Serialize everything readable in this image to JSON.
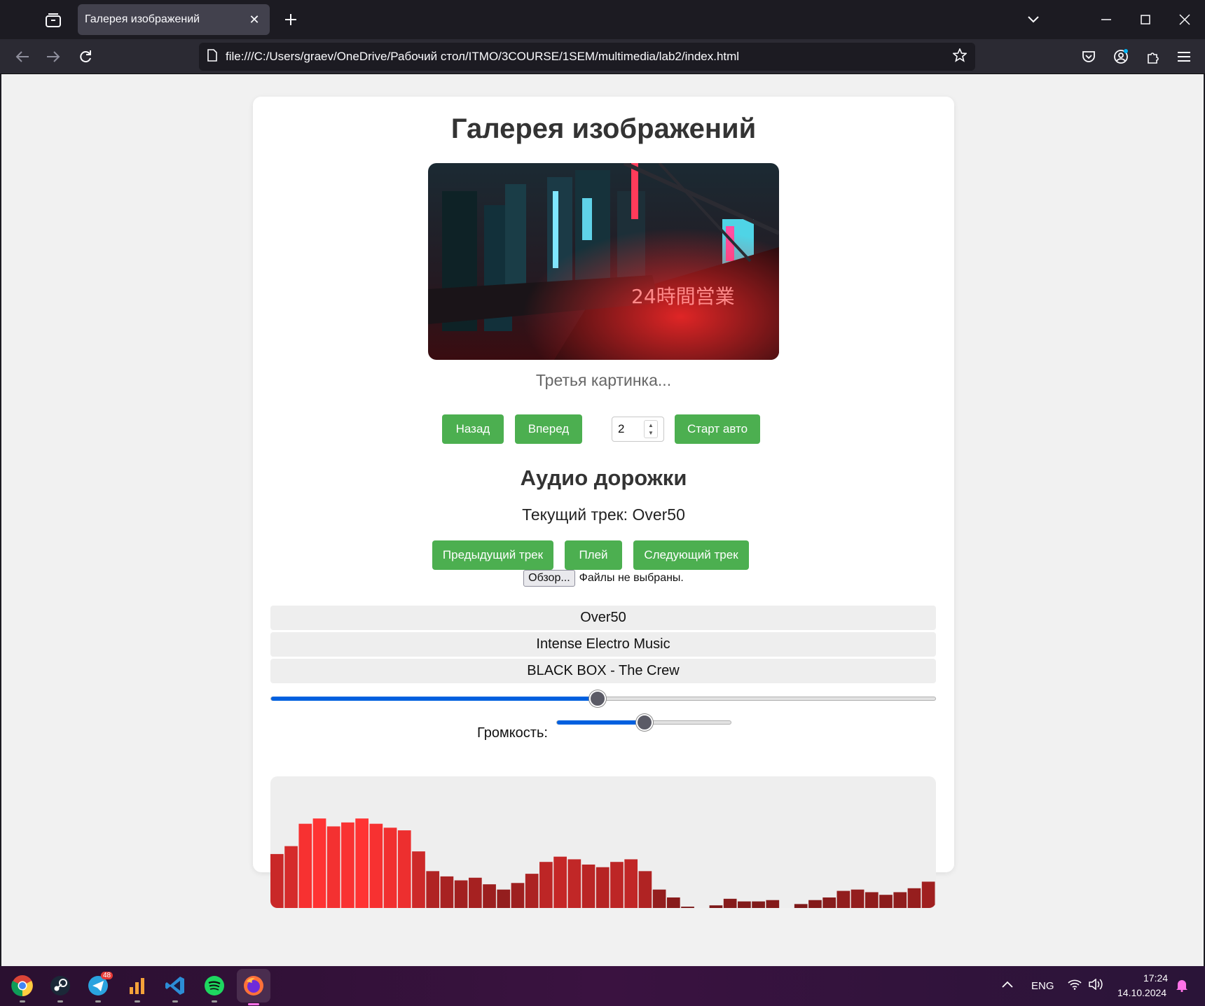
{
  "browser": {
    "tab_title": "Галерея изображений",
    "url": "file:///C:/Users/graev/OneDrive/Рабочий стол/ITMO/3COURSE/1SEM/multimedia/lab2/index.html"
  },
  "page": {
    "gallery_title": "Галерея изображений",
    "image_caption": "Третья картинка...",
    "prev_label": "Назад",
    "next_label": "Вперед",
    "interval_value": "2",
    "auto_label": "Старт авто",
    "audio_title": "Аудио дорожки",
    "current_track": "Текущий трек: Over50",
    "prev_track_label": "Предыдущий трек",
    "play_label": "Плей",
    "next_track_label": "Следующий трек",
    "browse_label": "Обзор...",
    "file_status": "Файлы не выбраны.",
    "tracks": [
      "Over50",
      "Intense Electro Music",
      "BLACK BOX - The Crew"
    ],
    "progress_fraction": 0.49,
    "volume_label": "Громкость:",
    "volume_fraction": 0.5,
    "visualizer_levels": [
      0.41,
      0.47,
      0.64,
      0.68,
      0.62,
      0.65,
      0.68,
      0.64,
      0.61,
      0.59,
      0.43,
      0.28,
      0.24,
      0.21,
      0.23,
      0.18,
      0.14,
      0.19,
      0.26,
      0.35,
      0.39,
      0.37,
      0.33,
      0.31,
      0.35,
      0.37,
      0.28,
      0.14,
      0.08,
      0.01,
      0,
      0.02,
      0.07,
      0.05,
      0.05,
      0.06,
      0,
      0.03,
      0.06,
      0.08,
      0.13,
      0.14,
      0.12,
      0.1,
      0.12,
      0.15,
      0.2
    ]
  },
  "taskbar": {
    "telegram_badge": "48",
    "lang": "ENG",
    "time": "17:24",
    "date": "14.10.2024"
  },
  "colors": {
    "accent_green": "#4caf50",
    "range_blue": "#0060df",
    "bar_red": "#ff3333"
  }
}
